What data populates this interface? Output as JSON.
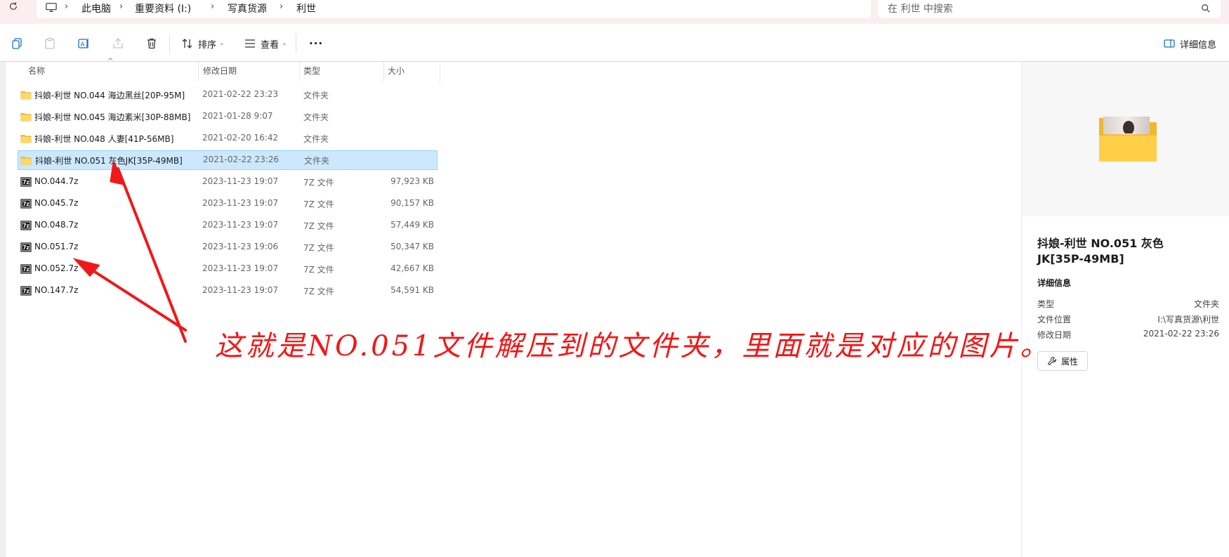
{
  "addressbar": {
    "breadcrumb": [
      "此电脑",
      "重要资料 (I:)",
      "写真货源",
      "利世"
    ],
    "search_placeholder": "在 利世 中搜索"
  },
  "toolbar": {
    "sort_label": "排序",
    "view_label": "查看",
    "more_label": "···",
    "details_label": "详细信息"
  },
  "columns": {
    "name": "名称",
    "date": "修改日期",
    "type": "类型",
    "size": "大小"
  },
  "files": [
    {
      "kind": "folder",
      "name": "抖娘-利世 NO.044 海边黑丝[20P-95M]",
      "date": "2021-02-22 23:23",
      "type": "文件夹",
      "size": ""
    },
    {
      "kind": "folder",
      "name": "抖娘-利世 NO.045 海边紊米[30P-88MB]",
      "date": "2021-01-28 9:07",
      "type": "文件夹",
      "size": ""
    },
    {
      "kind": "folder",
      "name": "抖娘-利世 NO.048 人妻[41P-56MB]",
      "date": "2021-02-20 16:42",
      "type": "文件夹",
      "size": ""
    },
    {
      "kind": "folder",
      "name": "抖娘-利世 NO.051 灰色JK[35P-49MB]",
      "date": "2021-02-22 23:26",
      "type": "文件夹",
      "size": "",
      "selected": true
    },
    {
      "kind": "7z",
      "name": "NO.044.7z",
      "date": "2023-11-23 19:07",
      "type": "7Z 文件",
      "size": "97,923 KB"
    },
    {
      "kind": "7z",
      "name": "NO.045.7z",
      "date": "2023-11-23 19:07",
      "type": "7Z 文件",
      "size": "90,157 KB"
    },
    {
      "kind": "7z",
      "name": "NO.048.7z",
      "date": "2023-11-23 19:07",
      "type": "7Z 文件",
      "size": "57,449 KB"
    },
    {
      "kind": "7z",
      "name": "NO.051.7z",
      "date": "2023-11-23 19:06",
      "type": "7Z 文件",
      "size": "50,347 KB"
    },
    {
      "kind": "7z",
      "name": "NO.052.7z",
      "date": "2023-11-23 19:07",
      "type": "7Z 文件",
      "size": "42,667 KB"
    },
    {
      "kind": "7z",
      "name": "NO.147.7z",
      "date": "2023-11-23 19:07",
      "type": "7Z 文件",
      "size": "54,591 KB"
    }
  ],
  "details": {
    "title_line1": "抖娘-利世 NO.051 灰色",
    "title_line2": "JK[35P-49MB]",
    "section": "详细信息",
    "rows": [
      {
        "key": "类型",
        "value": "文件夹"
      },
      {
        "key": "文件位置",
        "value": "I:\\写真货源\\利世"
      },
      {
        "key": "修改日期",
        "value": "2021-02-22 23:26"
      }
    ],
    "properties_button": "属性"
  },
  "annotation": {
    "text": "这就是NO.051文件解压到的文件夹，里面就是对应的图片。",
    "color": "#f01818"
  }
}
